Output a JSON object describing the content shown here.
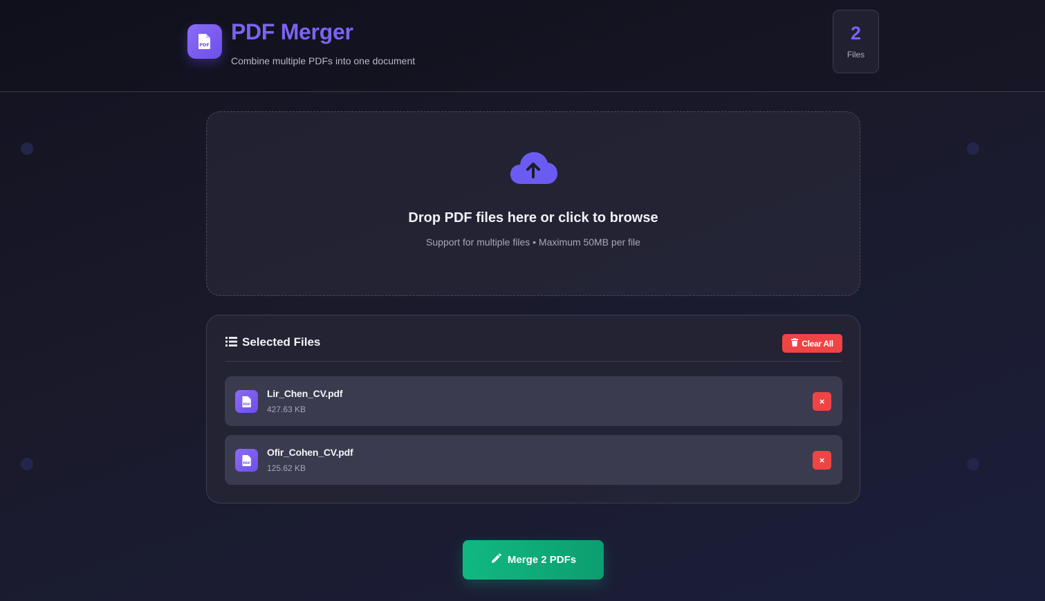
{
  "header": {
    "title": "PDF Merger",
    "subtitle": "Combine multiple PDFs into one document",
    "file_count": "2",
    "file_count_label": "Files",
    "logo_icon": "pdf-file-icon"
  },
  "dropzone": {
    "icon": "cloud-upload-icon",
    "title": "Drop PDF files here or click to browse",
    "subtitle": "Support for multiple files • Maximum 50MB per file"
  },
  "files_panel": {
    "title": "Selected Files",
    "icon": "list-icon",
    "clear_label": "Clear All",
    "files": [
      {
        "name": "Lir_Chen_CV.pdf",
        "size": "427.63 KB"
      },
      {
        "name": "Ofir_Cohen_CV.pdf",
        "size": "125.62 KB"
      }
    ],
    "remove_label": "×"
  },
  "merge": {
    "label": "Merge 2 PDFs",
    "icon": "pencil-icon"
  },
  "colors": {
    "accent": "#7c63f0",
    "danger": "#ef4444",
    "success": "#10b981",
    "background": "#1a1a2b"
  }
}
